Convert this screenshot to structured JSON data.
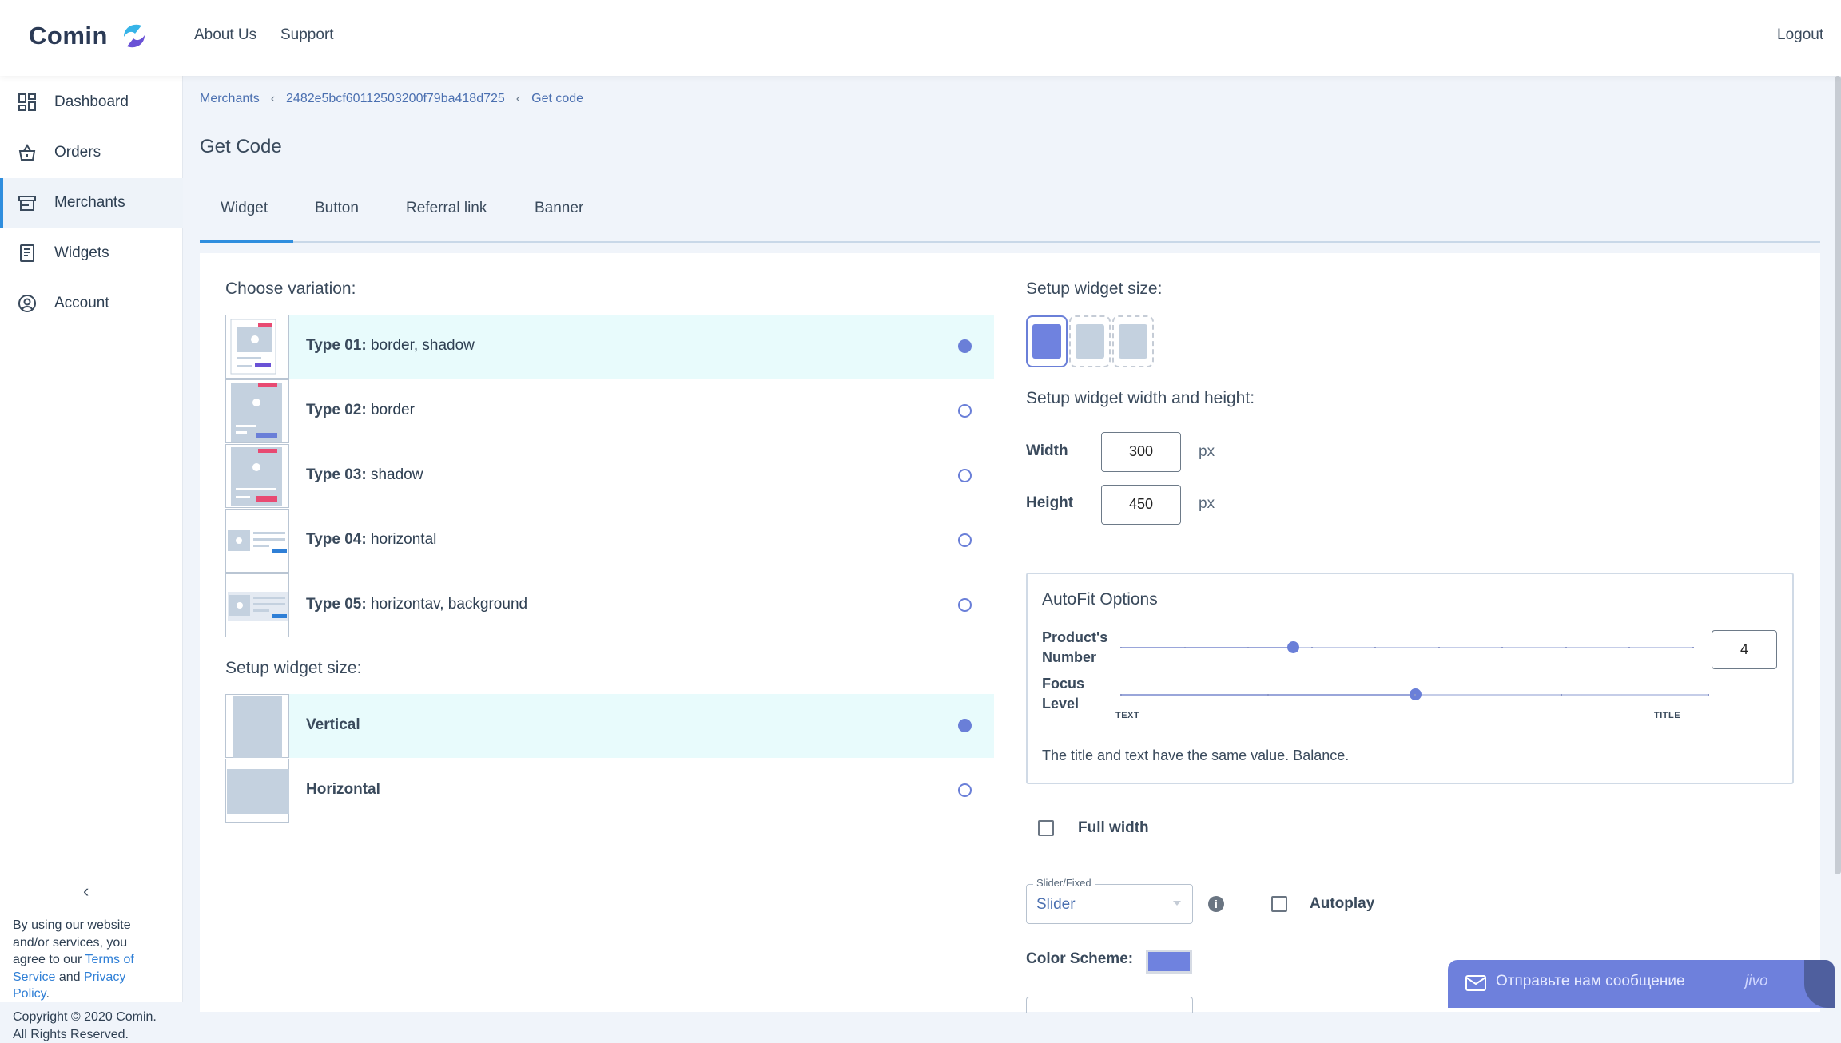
{
  "header": {
    "logo_text": "Comin",
    "nav": [
      "About Us",
      "Support"
    ],
    "logout_label": "Logout"
  },
  "sidebar": {
    "items": [
      {
        "label": "Dashboard",
        "icon": "dashboard-icon"
      },
      {
        "label": "Orders",
        "icon": "basket-icon"
      },
      {
        "label": "Merchants",
        "icon": "store-icon",
        "active": true
      },
      {
        "label": "Widgets",
        "icon": "widget-icon"
      },
      {
        "label": "Account",
        "icon": "user-circle-icon"
      }
    ],
    "legal_intro": "By using our website and/or services, you agree to our",
    "terms_link": "Terms of Service",
    "and_word": "and",
    "privacy_link": "Privacy Policy",
    "legal_end": ".",
    "copyright": "Copyright © 2020 Comin. All Rights Reserved."
  },
  "breadcrumb": [
    "Merchants",
    "2482e5bcf60112503200f79ba418d725",
    "Get code"
  ],
  "page_title": "Get Code",
  "tabs": [
    "Widget",
    "Button",
    "Referral link",
    "Banner"
  ],
  "variation": {
    "title": "Choose variation:",
    "items": [
      {
        "type": "Type 01:",
        "desc": "border, shadow",
        "selected": true
      },
      {
        "type": "Type 02:",
        "desc": "border",
        "selected": false
      },
      {
        "type": "Type 03:",
        "desc": "shadow",
        "selected": false
      },
      {
        "type": "Type 04:",
        "desc": "horizontal",
        "selected": false
      },
      {
        "type": "Type 05:",
        "desc": "horizontav, background",
        "selected": false
      }
    ]
  },
  "orientation": {
    "title": "Setup widget size:",
    "items": [
      {
        "label": "Vertical",
        "selected": true
      },
      {
        "label": "Horizontal",
        "selected": false
      }
    ]
  },
  "size_setup": {
    "title": "Setup widget size:",
    "selected_index": 0
  },
  "dimensions": {
    "title": "Setup widget width and height:",
    "width_label": "Width",
    "width_value": "300",
    "height_label": "Height",
    "height_value": "450",
    "unit": "px"
  },
  "autofit": {
    "title": "AutoFit Options",
    "products_label": "Product's Number",
    "products_value": "4",
    "products_slider_fraction": 0.3,
    "focus_label": "Focus Level",
    "focus_left": "TEXT",
    "focus_right": "TITLE",
    "focus_slider_fraction": 0.5,
    "note": "The title and text have the same value. Balance."
  },
  "options": {
    "full_width_label": "Full width",
    "full_width_checked": false,
    "mode_legend": "Slider/Fixed",
    "mode_value": "Slider",
    "autoplay_label": "Autoplay",
    "autoplay_checked": false,
    "color_scheme_label": "Color Scheme:",
    "color_scheme_value": "#6f82df"
  },
  "chat": {
    "text": "Отправьте нам сообщение",
    "brand": "jivo"
  },
  "colors": {
    "accent": "#2f8ede",
    "radio": "#6a7fd8",
    "selected_row": "#e8fbfc"
  }
}
